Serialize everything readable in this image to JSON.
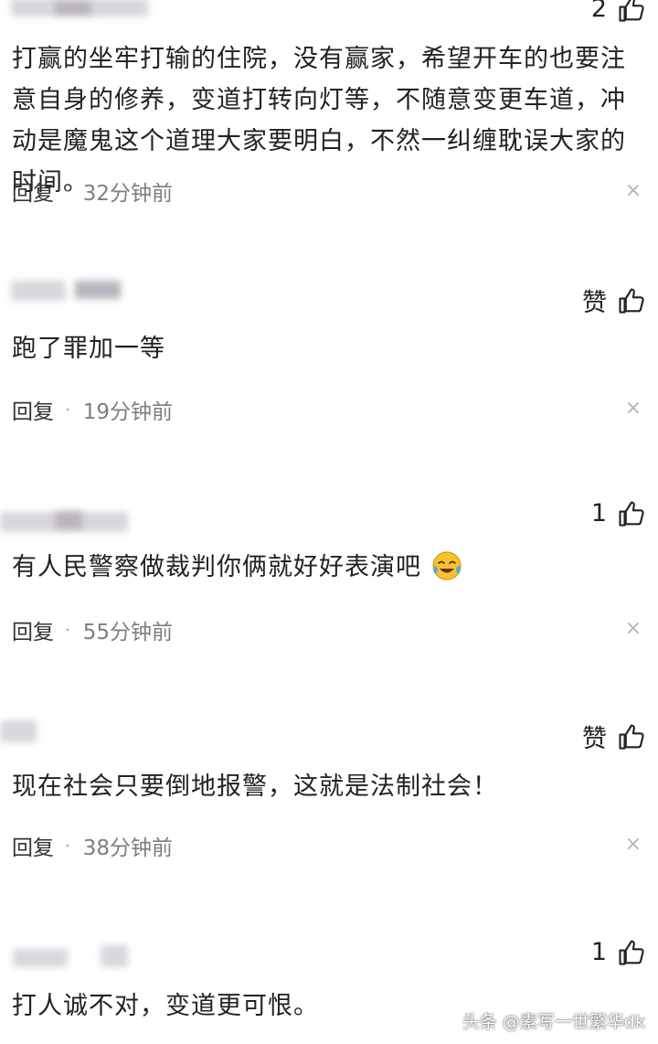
{
  "comments": [
    {
      "name_fragment": "",
      "likes": "2",
      "text": "打赢的坐牢打输的住院，没有赢家，希望开车的也要注意自身的修养，变道打转向灯等，不随意变更车道，冲动是魔鬼这个道理大家要明白，不然一纠缠耽误大家的时间。",
      "reply": "回复",
      "time": "32分钟前"
    },
    {
      "name_fragment": "",
      "likes": "赞",
      "text": "跑了罪加一等",
      "reply": "回复",
      "time": "19分钟前"
    },
    {
      "name_fragment": "",
      "likes": "1",
      "text": "有人民警察做裁判你俩就好好表演吧",
      "reply": "回复",
      "time": "55分钟前"
    },
    {
      "name_fragment": "",
      "likes": "赞",
      "text": "现在社会只要倒地报警，这就是法制社会！",
      "reply": "回复",
      "time": "38分钟前"
    },
    {
      "name_fragment": "",
      "likes": "1",
      "text": "打人诚不对，变道更可恨。"
    }
  ],
  "close_symbol": "×",
  "separator": "·",
  "watermark": "头条 @素写一世繁华dk",
  "icons": {
    "like": "thumb-up-icon",
    "close": "close-icon",
    "emoji": "crying-laughing-emoji"
  },
  "colors": {
    "text": "#222222",
    "time": "#7e7e7e",
    "close": "#b5b5b5",
    "blur": "#d9d6dc"
  }
}
